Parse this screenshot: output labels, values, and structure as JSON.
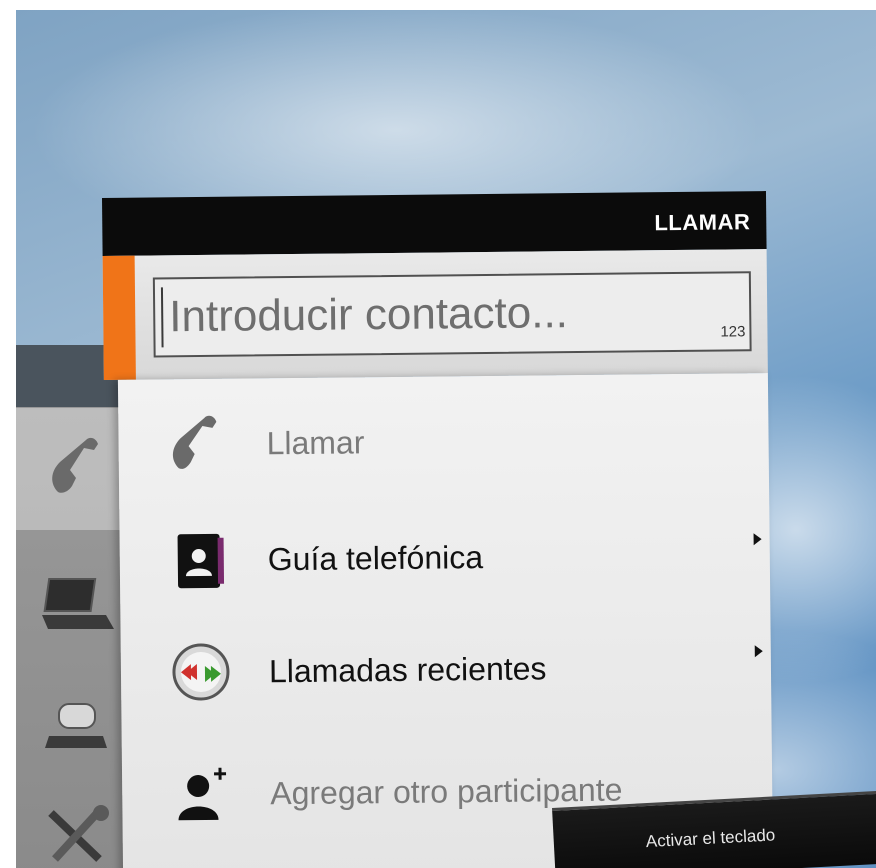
{
  "panel": {
    "title": "LLAMAR",
    "search": {
      "placeholder": "Introducir contacto...",
      "value": "",
      "mode_badge": "123"
    },
    "menu": [
      {
        "label": "Llamar",
        "icon": "phone-icon",
        "enabled": false,
        "has_submenu": false
      },
      {
        "label": "Guía telefónica",
        "icon": "phonebook-icon",
        "enabled": true,
        "has_submenu": true
      },
      {
        "label": "Llamadas recientes",
        "icon": "recent-calls-icon",
        "enabled": true,
        "has_submenu": true
      },
      {
        "label": "Agregar otro participante",
        "icon": "add-participant-icon",
        "enabled": false,
        "has_submenu": false
      }
    ]
  },
  "sidebar": {
    "items": [
      {
        "icon": "phone-icon",
        "active": true
      },
      {
        "icon": "laptop-icon",
        "active": false
      },
      {
        "icon": "camera-icon",
        "active": false
      },
      {
        "icon": "tools-icon",
        "active": false
      }
    ]
  },
  "softkeys": {
    "keyboard_label": "Activar el teclado"
  },
  "colors": {
    "accent": "#f07418",
    "header": "#0b0b0b",
    "recent_left_arrows": "#d0312d",
    "recent_right_arrows": "#3a9a2f"
  }
}
